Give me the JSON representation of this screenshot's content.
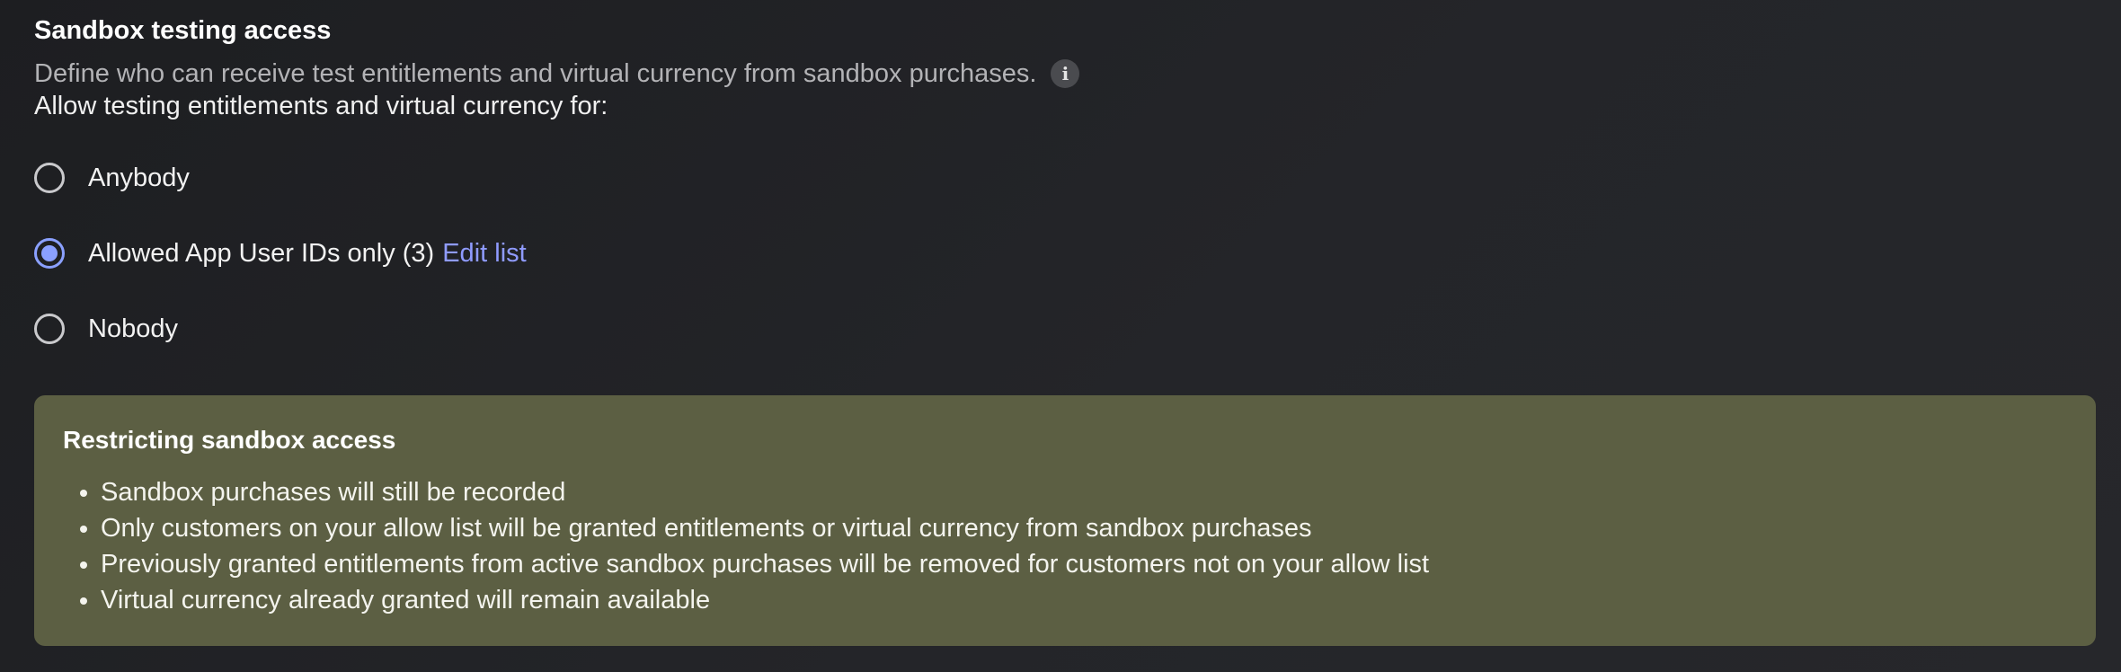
{
  "section": {
    "title": "Sandbox testing access",
    "description": "Define who can receive test entitlements and virtual currency from sandbox purchases.",
    "info_icon": "info-icon",
    "allow_label": "Allow testing entitlements and virtual currency for:"
  },
  "options": [
    {
      "label": "Anybody",
      "selected": false
    },
    {
      "label": "Allowed App User IDs only (3)",
      "selected": true,
      "link": "Edit list"
    },
    {
      "label": "Nobody",
      "selected": false
    }
  ],
  "notice": {
    "title": "Restricting sandbox access",
    "items": [
      "Sandbox purchases will still be recorded",
      "Only customers on your allow list will be granted entitlements or virtual currency from sandbox purchases",
      "Previously granted entitlements from active sandbox purchases will be removed for customers not on your allow list",
      "Virtual currency already granted will remain available"
    ],
    "background": "#5c5f43"
  },
  "colors": {
    "accent": "#8aa0ff",
    "link": "#8f9bff"
  }
}
